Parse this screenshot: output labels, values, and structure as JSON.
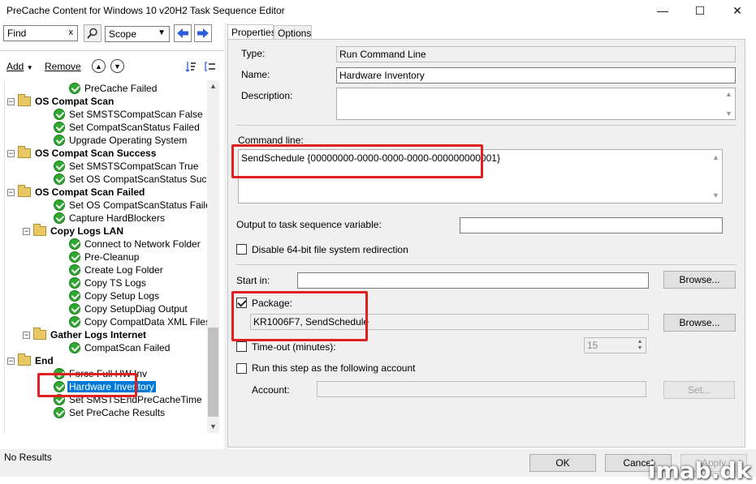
{
  "window": {
    "title": "PreCache Content for Windows 10 v20H2 Task Sequence Editor",
    "minimize": "—",
    "maximize": "☐",
    "close": "✕"
  },
  "find": {
    "value": "Find",
    "clear": "x"
  },
  "scope": {
    "value": "Scope"
  },
  "toolbar": {
    "add": "Add",
    "remove": "Remove"
  },
  "tree": [
    {
      "label": "PreCache Failed",
      "type": "step",
      "level": 3
    },
    {
      "label": "OS Compat Scan",
      "type": "group",
      "level": 0
    },
    {
      "label": "Set SMSTSCompatScan False",
      "type": "step",
      "level": 2
    },
    {
      "label": "Set CompatScanStatus Failed",
      "type": "step",
      "level": 2
    },
    {
      "label": "Upgrade Operating System",
      "type": "step",
      "level": 2
    },
    {
      "label": "OS Compat Scan Success",
      "type": "group",
      "level": 0
    },
    {
      "label": "Set SMSTSCompatScan True",
      "type": "step",
      "level": 2
    },
    {
      "label": "Set OS CompatScanStatus Success",
      "type": "step",
      "level": 2
    },
    {
      "label": "OS Compat Scan Failed",
      "type": "group",
      "level": 0
    },
    {
      "label": "Set OS CompatScanStatus Failed",
      "type": "step",
      "level": 2
    },
    {
      "label": "Capture HardBlockers",
      "type": "step",
      "level": 2
    },
    {
      "label": "Copy Logs LAN",
      "type": "group",
      "level": 1
    },
    {
      "label": "Connect to Network Folder",
      "type": "step",
      "level": 3
    },
    {
      "label": "Pre-Cleanup",
      "type": "step",
      "level": 3
    },
    {
      "label": "Create Log Folder",
      "type": "step",
      "level": 3
    },
    {
      "label": "Copy TS Logs",
      "type": "step",
      "level": 3
    },
    {
      "label": "Copy Setup Logs",
      "type": "step",
      "level": 3
    },
    {
      "label": "Copy SetupDiag Output",
      "type": "step",
      "level": 3
    },
    {
      "label": "Copy CompatData XML Files",
      "type": "step",
      "level": 3
    },
    {
      "label": "Gather Logs Internet",
      "type": "group",
      "level": 1
    },
    {
      "label": "CompatScan Failed",
      "type": "step",
      "level": 3
    },
    {
      "label": "End",
      "type": "group",
      "level": 0
    },
    {
      "label": "Force Full HW Inv",
      "type": "step",
      "level": 2
    },
    {
      "label": "Hardware Inventory",
      "type": "step",
      "level": 2,
      "selected": true
    },
    {
      "label": "Set SMSTSEndPreCacheTime",
      "type": "step",
      "level": 2
    },
    {
      "label": "Set PreCache Results",
      "type": "step",
      "level": 2
    }
  ],
  "tabs": [
    "Properties",
    "Options"
  ],
  "props": {
    "type_label": "Type:",
    "type_value": "Run Command Line",
    "name_label": "Name:",
    "name_value": "Hardware Inventory",
    "desc_label": "Description:",
    "desc_value": "",
    "cmd_label": "Command line:",
    "cmd_value": "SendSchedule {00000000-0000-0000-0000-000000000001}",
    "output_label": "Output to task sequence variable:",
    "output_value": "",
    "disable64_label": "Disable 64-bit file system redirection",
    "startin_label": "Start in:",
    "startin_value": "",
    "browse1": "Browse...",
    "package_label": "Package:",
    "package_value": "KR1006F7, SendSchedule",
    "browse2": "Browse...",
    "timeout_label": "Time-out (minutes):",
    "timeout_value": "15",
    "runas_label": "Run this step as the following account",
    "account_label": "Account:",
    "account_value": "",
    "set_button": "Set..."
  },
  "status": {
    "text": "No Results"
  },
  "buttons": {
    "ok": "OK",
    "cancel": "Cancel",
    "apply": "Apply"
  },
  "watermark": "imab.dk"
}
